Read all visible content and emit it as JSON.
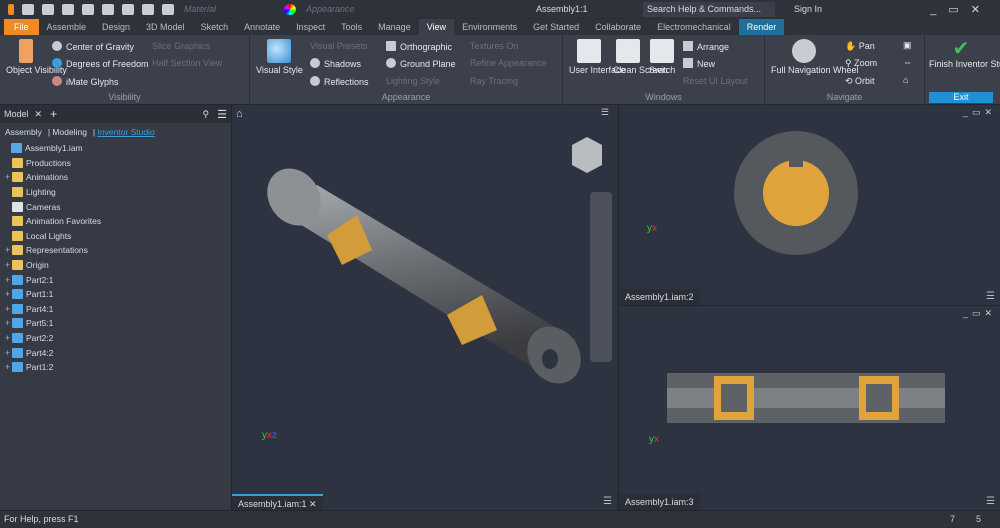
{
  "qat": {
    "material": "Material",
    "appearance": "Appearance",
    "title": "Assembly1:1",
    "search": "Search Help & Commands...",
    "sign_in": "Sign In"
  },
  "tabs": [
    "File",
    "Assemble",
    "Design",
    "3D Model",
    "Sketch",
    "Annotate",
    "Inspect",
    "Tools",
    "Manage",
    "View",
    "Environments",
    "Get Started",
    "Collaborate",
    "Electromechanical",
    "Render"
  ],
  "ribbon": {
    "visibility": {
      "label": "Visibility",
      "object_visibility": "Object Visibility",
      "cog": "Center of Gravity",
      "dof": "Degrees of Freedom",
      "imate": "iMate Glyphs",
      "slice": "Slice Graphics",
      "half": "Half Section View"
    },
    "appearance": {
      "label": "Appearance",
      "visual_style": "Visual Style",
      "presets": "Visual Presets",
      "shadows": "Shadows",
      "reflections": "Reflections",
      "ortho": "Orthographic",
      "ground": "Ground Plane",
      "lighting": "Lighting Style",
      "textures": "Textures On",
      "refine": "Refine Appearance",
      "ray": "Ray Tracing"
    },
    "windows": {
      "label": "Windows",
      "ui": "User Interface",
      "clean": "Clean Screen",
      "switch": "Switch",
      "arrange": "Arrange",
      "new": "New",
      "reset": "Reset UI Layout"
    },
    "navigate": {
      "label": "Navigate",
      "wheel": "Full Navigation Wheel",
      "pan": "Pan",
      "zoom": "Zoom",
      "orbit": "Orbit"
    },
    "exit": {
      "finish": "Finish Inventor Studio",
      "exit": "Exit"
    }
  },
  "browser": {
    "title": "Model",
    "tabs": [
      "Assembly",
      "Modeling",
      "Inventor Studio"
    ],
    "nodes": [
      {
        "label": "Assembly1.iam",
        "plus": ""
      },
      {
        "label": "Productions",
        "plus": ""
      },
      {
        "label": "Animations",
        "plus": "+"
      },
      {
        "label": "Lighting",
        "plus": ""
      },
      {
        "label": "Cameras",
        "plus": ""
      },
      {
        "label": "Animation Favorites",
        "plus": ""
      },
      {
        "label": "Local Lights",
        "plus": ""
      },
      {
        "label": "Representations",
        "plus": "+"
      },
      {
        "label": "Origin",
        "plus": "+"
      },
      {
        "label": "Part2:1",
        "plus": "+"
      },
      {
        "label": "Part1:1",
        "plus": "+"
      },
      {
        "label": "Part4:1",
        "plus": "+"
      },
      {
        "label": "Part5:1",
        "plus": "+"
      },
      {
        "label": "Part2:2",
        "plus": "+"
      },
      {
        "label": "Part4:2",
        "plus": "+"
      },
      {
        "label": "Part1:2",
        "plus": "+"
      }
    ]
  },
  "viewports": [
    "Assembly1.iam:1",
    "Assembly1.iam:2",
    "Assembly1.iam:3"
  ],
  "status": {
    "help": "For Help, press F1",
    "n1": "7",
    "n2": "5"
  }
}
